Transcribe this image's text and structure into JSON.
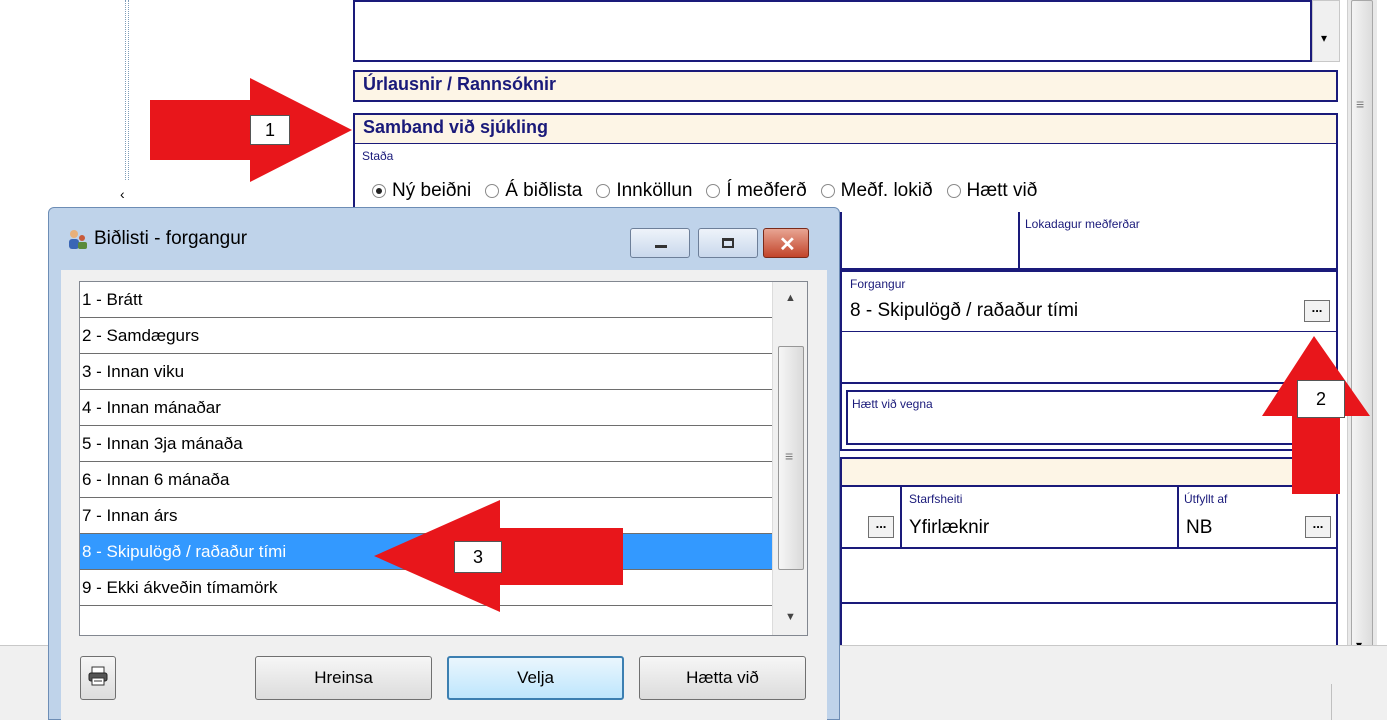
{
  "form": {
    "section_urlausnir": "Úrlausnir / Rannsóknir",
    "section_samband": "Samband við sjúkling",
    "stada_label": "Staða",
    "stada_options": [
      "Ný beiðni",
      "Á biðlista",
      "Innköllun",
      "Í meðferð",
      "Meðf. lokið",
      "Hætt við"
    ],
    "stada_selected": "Ný beiðni",
    "lokadagur_label": "Lokadagur meðferðar",
    "forgangur_label": "Forgangur",
    "forgangur_value": "8 - Skipulögð / raðaður tími",
    "haett_vid_vegna_label": "Hætt við vegna",
    "starfsheiti_label": "Starfsheiti",
    "starfsheiti_value": "Yfirlæknir",
    "utfyllt_af_label": "Útfyllt af",
    "utfyllt_af_value": "NB",
    "ellipsis": "..."
  },
  "dialog": {
    "title": "Biðlisti - forgangur",
    "items": [
      "1 - Brátt",
      "2 - Samdægurs",
      "3 - Innan viku",
      "4 - Innan mánaðar",
      "5 - Innan 3ja mánaða",
      "6 - Innan 6 mánaða",
      "7 - Innan árs",
      "8 - Skipulögð / raðaður tími",
      "9 - Ekki ákveðin tímamörk"
    ],
    "selected_index": 7,
    "buttons": {
      "hreinsa": "Hreinsa",
      "velja": "Velja",
      "haetta_vid": "Hætta við"
    }
  },
  "annotations": {
    "callout_1": "1",
    "callout_2": "2",
    "callout_3": "3",
    "arrow_color": "#e8161b"
  },
  "colors": {
    "navy": "#1a1a7a",
    "section_bg": "#fdf5e6",
    "selection": "#3399ff"
  }
}
